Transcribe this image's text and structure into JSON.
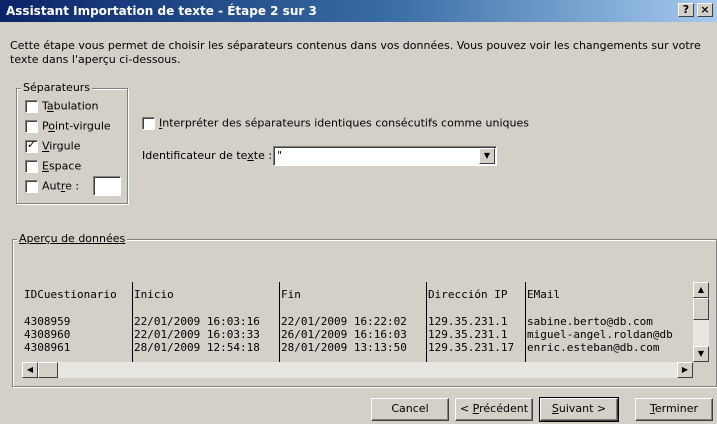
{
  "window": {
    "title": "Assistant Importation de texte - Étape 2 sur 3",
    "help_label": "?",
    "close_label": "×"
  },
  "intro_text": "Cette étape vous permet de choisir les séparateurs contenus dans vos données. Vous pouvez voir les changements sur votre texte dans l'aperçu ci-dessous.",
  "separators": {
    "legend": "Séparateurs",
    "items": [
      {
        "pre": "T",
        "ul": "a",
        "post": "bulation",
        "checked": false
      },
      {
        "pre": "P",
        "ul": "o",
        "post": "int-virgule",
        "checked": false
      },
      {
        "pre": "",
        "ul": "V",
        "post": "irgule",
        "checked": true
      },
      {
        "pre": "",
        "ul": "E",
        "post": "space",
        "checked": false
      },
      {
        "pre": "Aut",
        "ul": "r",
        "post": "e :",
        "checked": false
      }
    ],
    "other_value": ""
  },
  "consecutive": {
    "pre": "",
    "ul": "I",
    "post": "nterpréter des séparateurs identiques consécutifs comme uniques",
    "checked": false
  },
  "text_qualifier": {
    "pre": "Identificateur de te",
    "ul": "x",
    "post": "te :",
    "value": "\""
  },
  "preview": {
    "legend": "Aperçu de données",
    "columns": [
      "IDCuestionario",
      "Inicio",
      "Fin",
      "Dirección IP",
      "EMail"
    ],
    "rows": [
      [
        "4308959",
        "22/01/2009 16:03:16",
        "22/01/2009 16:22:02",
        "129.35.231.1",
        "sabine.berto@db.com"
      ],
      [
        "4308960",
        "22/01/2009 16:03:33",
        "26/01/2009 16:16:03",
        "129.35.231.1",
        "miguel-angel.roldan@db"
      ],
      [
        "4308961",
        "28/01/2009 12:54:18",
        "28/01/2009 13:13:50",
        "129.35.231.17",
        "enric.esteban@db.com"
      ]
    ]
  },
  "buttons": {
    "cancel": {
      "pre": "Cancel",
      "ul": "",
      "post": ""
    },
    "previous": {
      "pre": "< ",
      "ul": "P",
      "post": "récédent"
    },
    "next": {
      "pre": "",
      "ul": "S",
      "post": "uivant >"
    },
    "finish": {
      "pre": "",
      "ul": "T",
      "post": "erminer"
    }
  },
  "icons": {
    "check": "✓",
    "arrow_up": "▲",
    "arrow_down": "▼",
    "arrow_left": "◀",
    "arrow_right": "▶"
  }
}
